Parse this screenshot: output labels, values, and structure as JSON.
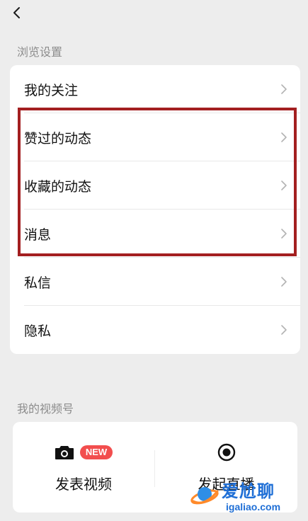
{
  "header": {
    "back_icon": "chevron-left-icon"
  },
  "browse_section": {
    "title": "浏览设置",
    "items": [
      {
        "label": "我的关注"
      },
      {
        "label": "赞过的动态"
      },
      {
        "label": "收藏的动态"
      },
      {
        "label": "消息"
      },
      {
        "label": "私信"
      },
      {
        "label": "隐私"
      }
    ]
  },
  "channel_section": {
    "title": "我的视频号",
    "actions": [
      {
        "label": "发表视频",
        "icon": "camera-icon",
        "badge": "NEW"
      },
      {
        "label": "发起直播",
        "icon": "record-icon"
      }
    ]
  },
  "watermark": {
    "title": "爱尬聊",
    "url": "igaliao.com",
    "icon": "planet-logo"
  },
  "colors": {
    "background": "#ededed",
    "highlight": "#a31f20",
    "badge": "#f24e4e",
    "watermark": "#1f6fd6"
  }
}
